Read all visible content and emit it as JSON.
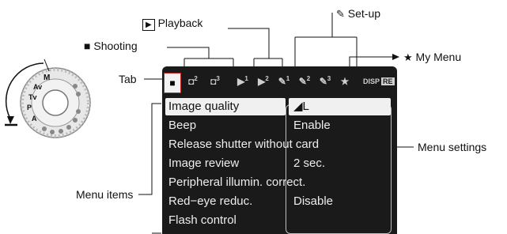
{
  "callouts": {
    "playback": "Playback",
    "setup": "Set-up",
    "shooting": "Shooting",
    "my_menu": "My Menu",
    "tab": "Tab",
    "menu_items": "Menu items",
    "menu_settings": "Menu settings"
  },
  "screen": {
    "disp_label": "DISP",
    "disp_box": "RE",
    "tabs": [
      {
        "glyph": "◘",
        "kind": "shooting",
        "active": true
      },
      {
        "glyph": "◘",
        "kind": "shooting"
      },
      {
        "glyph": "◘",
        "kind": "shooting"
      },
      {
        "glyph": "▶",
        "kind": "playback"
      },
      {
        "glyph": "▶",
        "kind": "playback"
      },
      {
        "glyph": "✎",
        "kind": "setup"
      },
      {
        "glyph": "✎",
        "kind": "setup"
      },
      {
        "glyph": "✎",
        "kind": "setup"
      },
      {
        "glyph": "★",
        "kind": "my-menu"
      }
    ],
    "menu": [
      {
        "name": "Image quality",
        "value": "◢L"
      },
      {
        "name": "Beep",
        "value": "Enable"
      },
      {
        "name": "Release shutter without card",
        "value": ""
      },
      {
        "name": "Image review",
        "value": "2 sec."
      },
      {
        "name": "Peripheral illumin. correct.",
        "value": ""
      },
      {
        "name": "Red−eye reduc.",
        "value": "Disable"
      },
      {
        "name": "Flash control",
        "value": ""
      }
    ]
  },
  "mode_dial": {
    "labels": [
      "M",
      "Av",
      "Tv",
      "P",
      "A"
    ]
  },
  "colors": {
    "screen_bg": "#1a1a1a",
    "highlight": "#f0f0f0",
    "active_tab_border": "#c62828"
  }
}
